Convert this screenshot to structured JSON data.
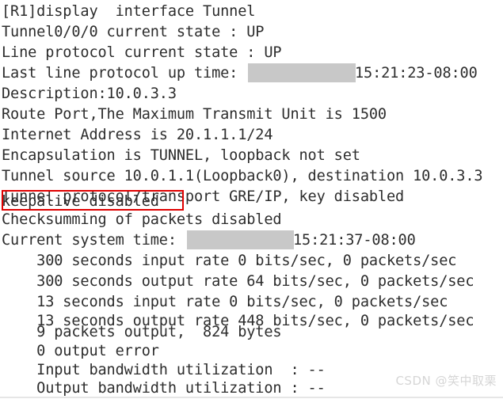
{
  "terminal": {
    "background_color": "#ffffff",
    "text_color": "#2d2d2d",
    "prompt": "[R1]",
    "command": "display  interface Tunnel",
    "lines": [
      {
        "text": "[R1]display  interface Tunnel",
        "indent": 0
      },
      {
        "text": "Tunnel0/0/0 current state : UP",
        "indent": 0
      },
      {
        "text": "Line protocol current state : UP",
        "indent": 0
      },
      {
        "text": "Last line protocol up time:",
        "indent": 0
      },
      {
        "text": "Description:10.0.3.3",
        "indent": 0
      },
      {
        "text": "Route Port,The Maximum Transmit Unit is 1500",
        "indent": 0
      },
      {
        "text": "Internet Address is 20.1.1.1/24",
        "indent": 0
      },
      {
        "text": "Encapsulation is TUNNEL, loopback not set",
        "indent": 0
      },
      {
        "text": "Tunnel source 10.0.1.1(Loopback0), destination 10.0.3.3",
        "indent": 0
      },
      {
        "text": "Tunnel protocol/transport GRE/IP, key disabled",
        "indent": 0
      },
      {
        "text": "keepalive disabled",
        "indent": 0
      },
      {
        "text": "Checksumming of packets disabled",
        "indent": 0
      },
      {
        "text": "Current system time:",
        "indent": 0
      },
      {
        "text": "    300 seconds input rate 0 bits/sec, 0 packets/sec",
        "indent": 4
      },
      {
        "text": "    300 seconds output rate 64 bits/sec, 0 packets/sec",
        "indent": 4
      },
      {
        "text": "    13 seconds input rate 0 bits/sec, 0 packets/sec",
        "indent": 4
      },
      {
        "text": "    13 seconds output rate 448 bits/sec, 0 packets/sec",
        "indent": 4
      },
      {
        "text": "    9 packets output,  824 bytes",
        "indent": 4
      },
      {
        "text": "    0 output error",
        "indent": 4
      },
      {
        "text": "    Input bandwidth utilization  : --",
        "indent": 4
      },
      {
        "text": "    Output bandwidth utilization : --",
        "indent": 4
      }
    ],
    "line_texts": {
      "l0": "[R1]display  interface Tunnel",
      "l1": "Tunnel0/0/0 current state : UP",
      "l2": "Line protocol current state : UP",
      "l3": "Last line protocol up time:",
      "l3_timestamp": "15:21:23-08:00",
      "l4": "Description:10.0.3.3",
      "l5": "Route Port,The Maximum Transmit Unit is 1500",
      "l6": "Internet Address is 20.1.1.1/24",
      "l7": "Encapsulation is TUNNEL, loopback not set",
      "l8": "Tunnel source 10.0.1.1(Loopback0), destination 10.0.3.3",
      "l9": "Tunnel protocol/transport GRE/IP, key disabled",
      "l10": "keepalive disabled",
      "l11": "Checksumming of packets disabled",
      "l12": "Current system time:",
      "l12_timestamp": "15:21:37-08:00",
      "l13": "    300 seconds input rate 0 bits/sec, 0 packets/sec",
      "l14": "    300 seconds output rate 64 bits/sec, 0 packets/sec",
      "l15": "    13 seconds input rate 0 bits/sec, 0 packets/sec",
      "l16": "    13 seconds output rate 448 bits/sec, 0 packets/sec",
      "l17": "    9 packets output,  824 bytes",
      "l18": "    0 output error",
      "l19": "    Input bandwidth utilization  : --",
      "l20": "    Output bandwidth utilization : --"
    }
  },
  "interface": {
    "name": "Tunnel0/0/0",
    "current_state": "UP",
    "line_protocol_state": "UP",
    "description": "10.0.3.3",
    "mtu": "1500",
    "internet_address": "20.1.1.1/24",
    "encapsulation": "TUNNEL",
    "loopback": "not set",
    "tunnel_source": "10.0.1.1(Loopback0)",
    "tunnel_destination": "10.0.3.3",
    "tunnel_protocol": "GRE/IP",
    "key": "disabled",
    "keepalive": "disabled",
    "checksumming": "disabled",
    "input_bandwidth_utilization": "--",
    "output_bandwidth_utilization": "--",
    "packets_output": "9",
    "bytes_output": "824",
    "output_error": "0"
  },
  "annotations": {
    "keepalive_box_color": "#e00000",
    "redaction_color": "#c8c8c8"
  },
  "watermark": {
    "text": "CSDN @笑中取栗"
  }
}
